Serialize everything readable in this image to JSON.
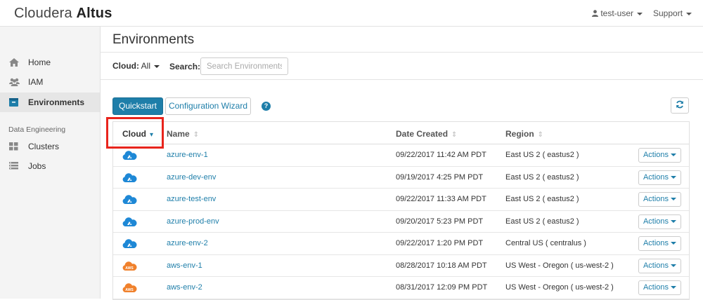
{
  "header": {
    "brand_light": "Cloudera",
    "brand_bold": "Altus",
    "user": "test-user",
    "support": "Support"
  },
  "sidebar": {
    "items": [
      {
        "label": "Home",
        "icon": "home-icon"
      },
      {
        "label": "IAM",
        "icon": "users-icon"
      },
      {
        "label": "Environments",
        "icon": "environment-icon",
        "active": true
      }
    ],
    "section_title": "Data Engineering",
    "section_items": [
      {
        "label": "Clusters",
        "icon": "grid-icon"
      },
      {
        "label": "Jobs",
        "icon": "list-icon"
      }
    ]
  },
  "main": {
    "title": "Environments",
    "cloud_filter_label": "Cloud:",
    "cloud_filter_value": "All",
    "search_label": "Search:",
    "search_placeholder": "Search Environments",
    "quickstart": "Quickstart",
    "wizard": "Configuration Wizard",
    "help": "?"
  },
  "table": {
    "columns": [
      "Cloud",
      "Name",
      "Date Created",
      "Region"
    ],
    "actions_label": "Actions",
    "rows": [
      {
        "cloud": "azure",
        "name": "azure-env-1",
        "date": "09/22/2017 11:42 AM PDT",
        "region": "East US 2 ( eastus2 )"
      },
      {
        "cloud": "azure",
        "name": "azure-dev-env",
        "date": "09/19/2017 4:25 PM PDT",
        "region": "East US 2 ( eastus2 )"
      },
      {
        "cloud": "azure",
        "name": "azure-test-env",
        "date": "09/22/2017 11:33 AM PDT",
        "region": "East US 2 ( eastus2 )"
      },
      {
        "cloud": "azure",
        "name": "azure-prod-env",
        "date": "09/20/2017 5:23 PM PDT",
        "region": "East US 2 ( eastus2 )"
      },
      {
        "cloud": "azure",
        "name": "azure-env-2",
        "date": "09/22/2017 1:20 PM PDT",
        "region": "Central US ( centralus )"
      },
      {
        "cloud": "aws",
        "name": "aws-env-1",
        "date": "08/28/2017 10:18 AM PDT",
        "region": "US West - Oregon ( us-west-2 )"
      },
      {
        "cloud": "aws",
        "name": "aws-env-2",
        "date": "08/31/2017 12:09 PM PDT",
        "region": "US West - Oregon ( us-west-2 )"
      }
    ]
  },
  "colors": {
    "primary": "#1e7ea9",
    "azure": "#1e88d6",
    "aws": "#f0812c",
    "highlight": "#e8241c"
  }
}
